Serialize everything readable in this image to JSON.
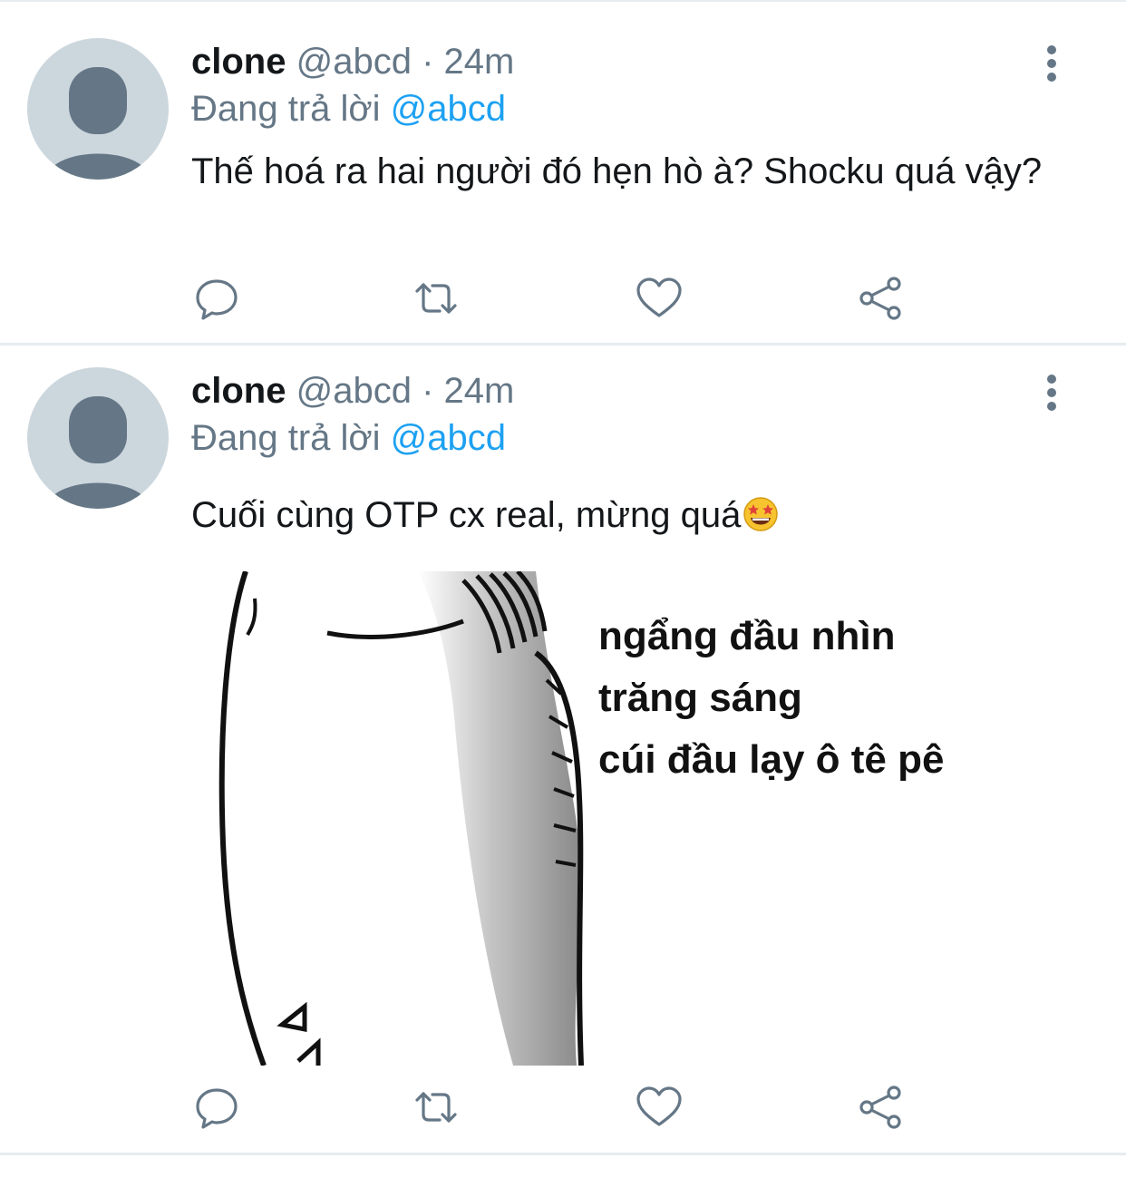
{
  "tweets": [
    {
      "author_name": "clone",
      "handle": "@abcd",
      "separator": "·",
      "time": "24m",
      "reply_prefix": "Đang trả lời",
      "reply_to": "@abcd",
      "text": "Thế hoá ra hai người đó hẹn hò à? Shocku quá vậy?"
    },
    {
      "author_name": "clone",
      "handle": "@abcd",
      "separator": "·",
      "time": "24m",
      "reply_prefix": "Đang trả lời",
      "reply_to": "@abcd",
      "text": "Cuối cùng OTP cx real, mừng quá",
      "emoji": "star-struck-emoji",
      "media_caption": [
        "ngẩng đầu nhìn",
        "trăng sáng",
        "cúi đầu lạy ô tê pê"
      ]
    }
  ],
  "icons": {
    "more": "more-vertical-icon",
    "reply": "reply-bubble-icon",
    "retweet": "retweet-icon",
    "like": "heart-icon",
    "share": "share-icon"
  },
  "colors": {
    "text": "#14171a",
    "secondary": "#657786",
    "link": "#1da1f2",
    "avatar_bg": "#ccd6dd",
    "avatar_fg": "#657786",
    "divider": "#e6ecf0"
  }
}
